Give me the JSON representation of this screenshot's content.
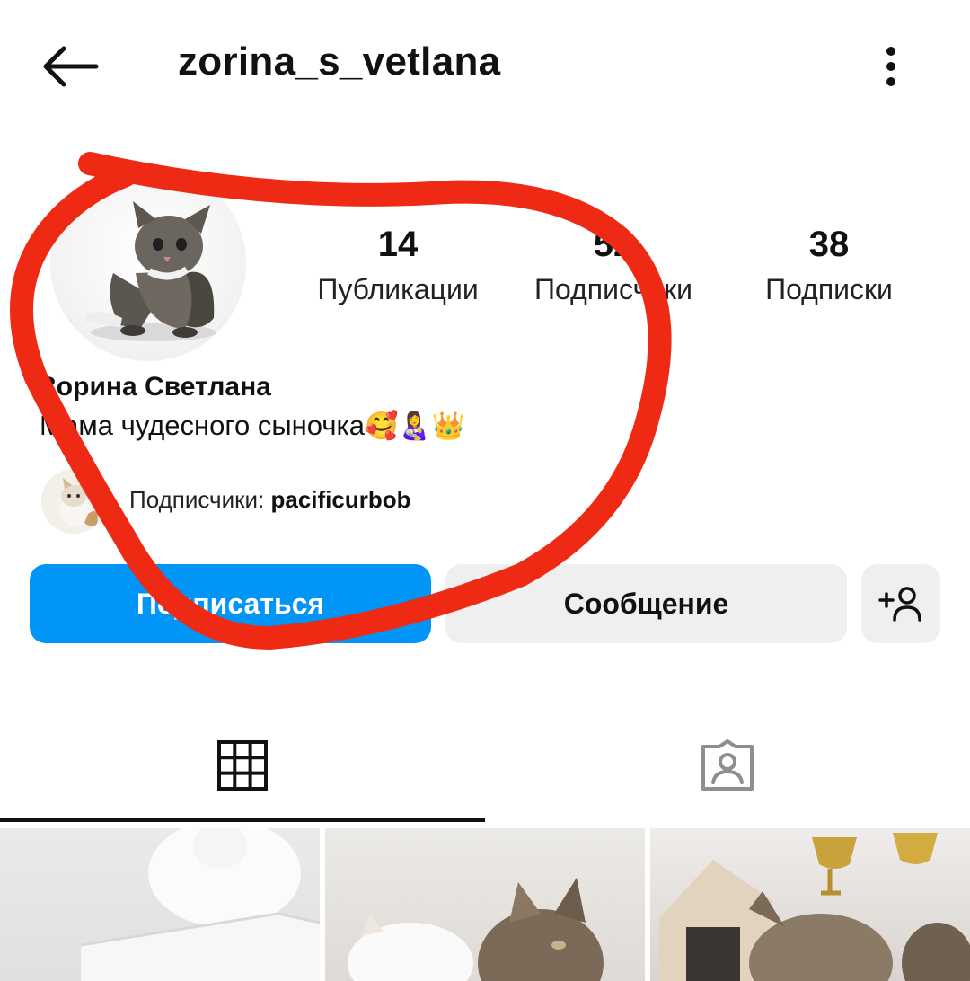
{
  "header": {
    "back_icon": "arrow-left-icon",
    "username": "zorina_s_vetlana",
    "more_icon": "more-vertical-icon"
  },
  "profile": {
    "avatar": "kitten-photo",
    "stats": {
      "posts": {
        "value": "14",
        "label": "Публикации"
      },
      "followers": {
        "value": "52",
        "label": "Подписчики"
      },
      "following": {
        "value": "38",
        "label": "Подписки"
      }
    },
    "full_name": "Зорина Светлана",
    "bio_text": "Мама чудесного сыночка",
    "bio_emojis": "🥰👩‍🍼👑",
    "mutual": {
      "prefix": "Подписчики: ",
      "user": "pacificurbob"
    }
  },
  "actions": {
    "follow": "Подписаться",
    "message": "Сообщение",
    "add_user_icon": "add-person-icon"
  },
  "tabs": [
    {
      "icon": "grid-icon",
      "active": true
    },
    {
      "icon": "tagged-person-icon",
      "active": false
    }
  ],
  "annotation": {
    "color": "#ee2a14",
    "shape": "hand-drawn-loop"
  },
  "colors": {
    "primary_button": "#0095f6",
    "secondary_button": "#efefef"
  }
}
